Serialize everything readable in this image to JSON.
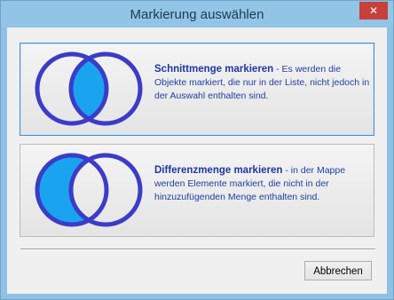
{
  "window": {
    "title": "Markierung auswählen",
    "close_icon": "close-icon"
  },
  "options": [
    {
      "title": "Schnittmenge markieren",
      "description": " - Es werden die Objekte markiert, die nur in der Liste, nicht jedoch in der Auswahl enthalten sind.",
      "icon": "venn-intersection-icon",
      "selected": true
    },
    {
      "title": "Differenzmenge markieren",
      "description": " - in der Mappe werden Elemente markiert, die nicht in der hinzuzufügenden Menge enthalten sind.",
      "icon": "venn-difference-icon",
      "selected": false
    }
  ],
  "footer": {
    "cancel_label": "Abbrechen"
  },
  "colors": {
    "ring": "#3c3cc8",
    "fill": "#1aa4f0",
    "title_bar": "#92c4e6",
    "close_button": "#c7403a",
    "selected_border": "#3c8ed8"
  }
}
